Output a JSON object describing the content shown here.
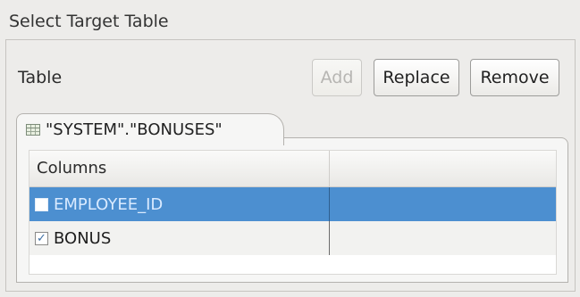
{
  "section": {
    "title": "Select Target Table"
  },
  "table_group": {
    "label": "Table",
    "buttons": {
      "add": "Add",
      "replace": "Replace",
      "remove": "Remove"
    }
  },
  "tab": {
    "icon": "table-icon",
    "label": "\"SYSTEM\".\"BONUSES\""
  },
  "columns_table": {
    "headers": [
      "Columns",
      ""
    ],
    "rows": [
      {
        "name": "EMPLOYEE_ID",
        "checked": false,
        "selected": true
      },
      {
        "name": "BONUS",
        "checked": true,
        "selected": false
      }
    ]
  },
  "colors": {
    "selection": "#4c8fd0",
    "background": "#edecea"
  }
}
